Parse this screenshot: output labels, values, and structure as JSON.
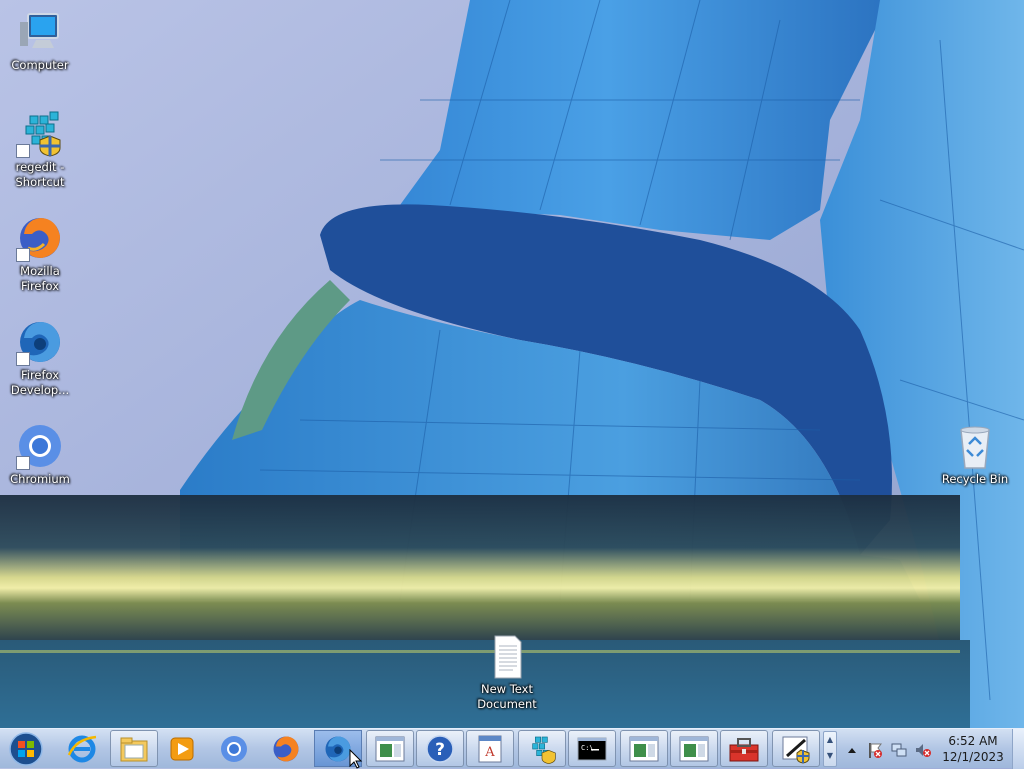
{
  "desktop": {
    "icons": [
      {
        "label": "Computer",
        "icon": "computer-icon"
      },
      {
        "label": "regedit - Shortcut",
        "icon": "regedit-icon"
      },
      {
        "label": "Mozilla Firefox",
        "icon": "firefox-icon"
      },
      {
        "label": "Firefox Develop...",
        "icon": "firefox-developer-icon"
      },
      {
        "label": "Chromium",
        "icon": "chromium-icon"
      },
      {
        "label": "Recycle Bin",
        "icon": "recycle-bin-icon"
      },
      {
        "label": "New Text Document",
        "icon": "text-document-icon"
      }
    ]
  },
  "taskbar": {
    "items": [
      {
        "icon": "internet-explorer-icon",
        "state": "pinned"
      },
      {
        "icon": "windows-explorer-icon",
        "state": "running"
      },
      {
        "icon": "media-player-icon",
        "state": "pinned"
      },
      {
        "icon": "chromium-icon",
        "state": "pinned"
      },
      {
        "icon": "firefox-icon",
        "state": "pinned"
      },
      {
        "icon": "firefox-developer-icon",
        "state": "active"
      },
      {
        "icon": "window-icon",
        "state": "running"
      },
      {
        "icon": "help-icon",
        "state": "running"
      },
      {
        "icon": "wordpad-icon",
        "state": "running"
      },
      {
        "icon": "regedit-icon",
        "state": "running"
      },
      {
        "icon": "command-prompt-icon",
        "state": "running"
      },
      {
        "icon": "window-icon",
        "state": "running"
      },
      {
        "icon": "window-icon",
        "state": "running"
      },
      {
        "icon": "toolbox-icon",
        "state": "running"
      },
      {
        "icon": "uac-edit-icon",
        "state": "running"
      }
    ],
    "tray_icons": [
      "show-hidden-icons-chevron",
      "action-center-flag-icon",
      "network-icon",
      "volume-muted-icon"
    ],
    "clock": {
      "time": "6:52 AM",
      "date": "12/1/2023"
    }
  },
  "colors": {
    "taskbar_accent": "#5a7db3",
    "wallpaper_blue": "#3c8ad6"
  }
}
